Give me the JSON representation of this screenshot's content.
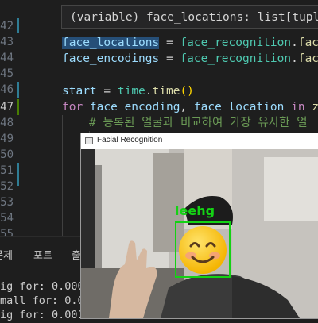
{
  "editor": {
    "line_numbers": [
      "42",
      "43",
      "44",
      "45",
      "46",
      "47",
      "48",
      "49",
      "50",
      "51",
      "52",
      "53",
      "54",
      "55"
    ],
    "active_line": "47",
    "hover": {
      "text": "(variable) face_locations: list[tuple["
    },
    "lines": {
      "l44": {
        "var": "face_locations",
        "eq": " = ",
        "mod": "face_recognition",
        "dot": ".",
        "fn": "face_"
      },
      "l45": {
        "var": "face_encodings",
        "eq": " = ",
        "mod": "face_recognition",
        "dot": ".",
        "fn": "face_"
      },
      "l47": {
        "var": "start",
        "eq": " = ",
        "mod": "time",
        "dot": ".",
        "fn": "time",
        "paren": "()"
      },
      "l48": {
        "kw_for": "for",
        "v1": " face_encoding",
        "comma": ", ",
        "v2": "face_location",
        "kw_in": " in",
        "fn": " zip"
      },
      "l49": {
        "comment": "# 등록된 얼굴과 비교하여 가장 유사한 얼"
      }
    }
  },
  "panel": {
    "tabs": [
      "문제",
      "포트",
      "출"
    ],
    "terminal_lines": [
      "ig for: 0.000",
      "mall for: 0.0",
      "ig for: 0.001"
    ]
  },
  "window": {
    "title": "Facial Recognition",
    "face_label": "leehg"
  }
}
